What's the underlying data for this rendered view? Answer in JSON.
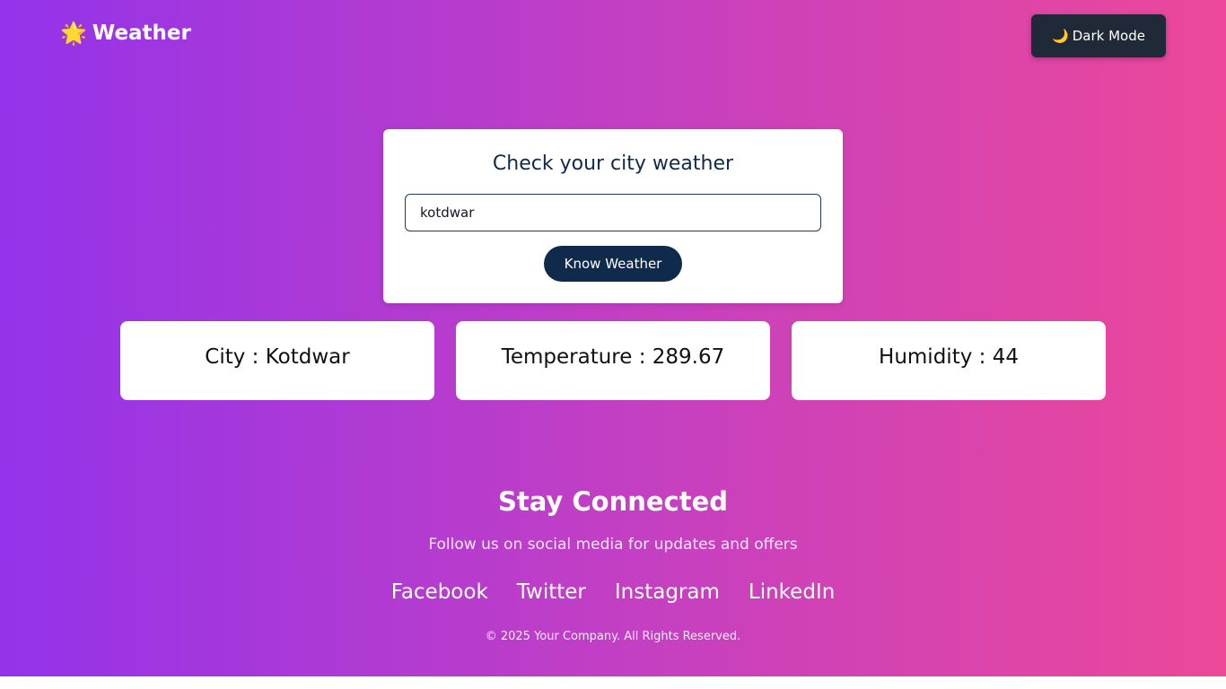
{
  "navbar": {
    "brand_icon": "🌟",
    "brand_title": "Weather",
    "dark_mode_icon": "🌙",
    "dark_mode_label": "Dark Mode"
  },
  "search": {
    "title": "Check your city weather",
    "input_value": "kotdwar",
    "button_label": "Know Weather"
  },
  "results": {
    "city": "City : Kotdwar",
    "temperature": "Temperature : 289.67",
    "humidity": "Humidity : 44"
  },
  "footer": {
    "title": "Stay Connected",
    "subtitle": "Follow us on social media for updates and offers",
    "links": [
      "Facebook",
      "Twitter",
      "Instagram",
      "LinkedIn"
    ],
    "copyright": "© 2025 Your Company. All Rights Reserved."
  },
  "colors": {
    "gradient_start": "#9333ea",
    "gradient_end": "#ec4899",
    "button_dark": "#1f2937",
    "button_primary": "#102a4c"
  }
}
